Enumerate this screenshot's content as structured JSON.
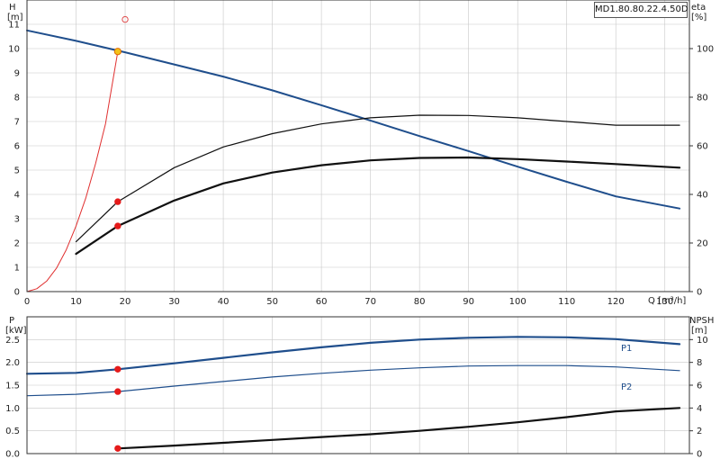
{
  "model": "MD1.80.80.22.4.50D",
  "chart_data": [
    {
      "type": "line",
      "panel": "top",
      "ylabel_left": [
        "H",
        "[m]"
      ],
      "ylabel_right": [
        "eta",
        "[%]"
      ],
      "xlabel": "Q [m³/h]",
      "xlim": [
        0,
        135
      ],
      "x_ticks": [
        0,
        10,
        20,
        30,
        40,
        50,
        60,
        70,
        80,
        90,
        100,
        110,
        120,
        130
      ],
      "ylim_left": [
        0,
        12
      ],
      "y_ticks_left": [
        0,
        1,
        2,
        3,
        4,
        5,
        6,
        7,
        8,
        9,
        10,
        11
      ],
      "ylim_right": [
        0,
        120
      ],
      "y_ticks_right": [
        0,
        20,
        40,
        60,
        80,
        100
      ],
      "grid": true,
      "series": [
        {
          "key": "H",
          "axis": "left",
          "color": "#1f4e8c",
          "width": 2,
          "x": [
            0,
            10,
            20,
            30,
            40,
            50,
            60,
            70,
            80,
            90,
            100,
            110,
            120,
            133
          ],
          "y": [
            10.75,
            10.32,
            9.85,
            9.35,
            8.85,
            8.28,
            7.67,
            7.04,
            6.4,
            5.78,
            5.14,
            4.52,
            3.92,
            3.42
          ]
        },
        {
          "key": "eta-thin",
          "axis": "right",
          "color": "#111111",
          "width": 1.2,
          "x": [
            10,
            18.5,
            30,
            40,
            50,
            60,
            70,
            80,
            90,
            100,
            110,
            120,
            133
          ],
          "y": [
            20.5,
            37,
            51,
            59.5,
            65,
            69,
            71.5,
            72.6,
            72.5,
            71.5,
            70,
            68.5,
            68.5
          ]
        },
        {
          "key": "eta-thick",
          "axis": "right",
          "color": "#111111",
          "width": 2.2,
          "x": [
            10,
            18.5,
            30,
            40,
            50,
            60,
            70,
            80,
            90,
            100,
            110,
            120,
            133
          ],
          "y": [
            15.5,
            27,
            37.5,
            44.5,
            49,
            52,
            54,
            55,
            55.2,
            54.5,
            53.5,
            52.5,
            51
          ]
        },
        {
          "key": "system",
          "axis": "left",
          "color": "#e03030",
          "width": 1,
          "x": [
            0,
            2,
            4,
            6,
            8,
            10,
            12,
            14,
            16,
            18.5
          ],
          "y": [
            0,
            0.12,
            0.43,
            0.96,
            1.72,
            2.7,
            3.86,
            5.28,
            6.9,
            9.88
          ]
        }
      ],
      "points": [
        {
          "key": "duty",
          "x": 18.5,
          "y": 9.88,
          "axis": "left",
          "fill": "#f3c21a",
          "stroke": "#e06b00",
          "r": 3.6
        },
        {
          "key": "set",
          "x": 20,
          "y": 11.2,
          "axis": "left",
          "fill": "none",
          "stroke": "#e05050",
          "r": 3.2
        },
        {
          "key": "eta-thin-pt",
          "x": 18.5,
          "y": 37,
          "axis": "right",
          "fill": "#e51b1b",
          "stroke": "#e51b1b",
          "r": 3.2
        },
        {
          "key": "eta-thick-pt",
          "x": 18.5,
          "y": 27,
          "axis": "right",
          "fill": "#e51b1b",
          "stroke": "#e51b1b",
          "r": 3.2
        }
      ]
    },
    {
      "type": "line",
      "panel": "bottom",
      "ylabel_left": [
        "P",
        "[kW]"
      ],
      "ylabel_right": [
        "NPSH",
        "[m]"
      ],
      "xlim": [
        0,
        135
      ],
      "ylim_left": [
        0,
        3
      ],
      "y_ticks_left": [
        0.0,
        0.5,
        1.0,
        1.5,
        2.0,
        2.5
      ],
      "ylim_right": [
        0,
        12
      ],
      "y_ticks_right": [
        0,
        2,
        4,
        6,
        8,
        10
      ],
      "grid": true,
      "series": [
        {
          "key": "P1",
          "name": "P1",
          "axis": "left",
          "color": "#1f4e8c",
          "width": 2.2,
          "x": [
            0,
            10,
            18.5,
            30,
            40,
            50,
            60,
            70,
            80,
            90,
            100,
            110,
            120,
            133
          ],
          "y": [
            1.75,
            1.77,
            1.85,
            1.98,
            2.1,
            2.22,
            2.33,
            2.43,
            2.5,
            2.54,
            2.56,
            2.55,
            2.51,
            2.4
          ]
        },
        {
          "key": "P2",
          "name": "P2",
          "axis": "left",
          "color": "#1f4e8c",
          "width": 1.2,
          "x": [
            0,
            10,
            18.5,
            30,
            40,
            50,
            60,
            70,
            80,
            90,
            100,
            110,
            120,
            133
          ],
          "y": [
            1.27,
            1.3,
            1.36,
            1.48,
            1.58,
            1.68,
            1.76,
            1.83,
            1.88,
            1.92,
            1.93,
            1.93,
            1.9,
            1.82
          ]
        },
        {
          "key": "NPSH",
          "axis": "right",
          "color": "#111111",
          "width": 2.2,
          "x": [
            18.5,
            30,
            40,
            50,
            60,
            70,
            80,
            90,
            100,
            110,
            120,
            133
          ],
          "y": [
            0.45,
            0.7,
            0.95,
            1.2,
            1.45,
            1.7,
            2.0,
            2.35,
            2.75,
            3.2,
            3.7,
            4.0
          ]
        }
      ],
      "points": [
        {
          "key": "P1-pt",
          "x": 18.5,
          "y": 1.85,
          "axis": "left",
          "fill": "#e51b1b",
          "stroke": "#e51b1b",
          "r": 3.2
        },
        {
          "key": "P2-pt",
          "x": 18.5,
          "y": 1.36,
          "axis": "left",
          "fill": "#e51b1b",
          "stroke": "#e51b1b",
          "r": 3.2
        },
        {
          "key": "NPSH-pt",
          "x": 18.5,
          "y": 0.45,
          "axis": "right",
          "fill": "#e51b1b",
          "stroke": "#e51b1b",
          "r": 3.2
        }
      ]
    }
  ]
}
